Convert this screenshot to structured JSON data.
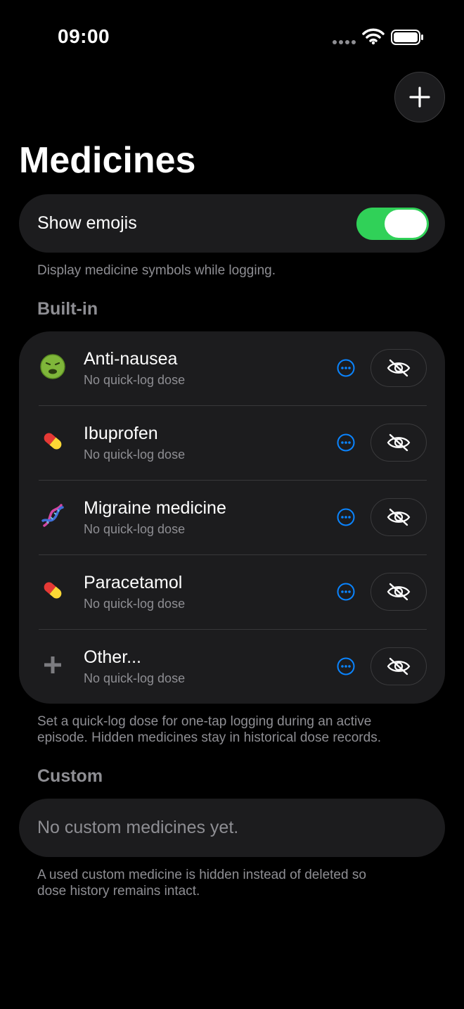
{
  "status_bar": {
    "time": "09:00"
  },
  "page": {
    "title": "Medicines"
  },
  "settings": {
    "show_emojis_label": "Show emojis",
    "show_emojis_on": true,
    "show_emojis_footnote": "Display medicine symbols while logging."
  },
  "builtin": {
    "header": "Built-in",
    "items": [
      {
        "name": "Anti-nausea",
        "subtitle": "No quick-log dose",
        "icon": "nauseated-face-icon"
      },
      {
        "name": "Ibuprofen",
        "subtitle": "No quick-log dose",
        "icon": "pill-icon"
      },
      {
        "name": "Migraine medicine",
        "subtitle": "No quick-log dose",
        "icon": "dna-icon"
      },
      {
        "name": "Paracetamol",
        "subtitle": "No quick-log dose",
        "icon": "pill-icon"
      },
      {
        "name": "Other...",
        "subtitle": "No quick-log dose",
        "icon": "plus-icon"
      }
    ],
    "footnote_line1": "Set a quick-log dose for one-tap logging during an active",
    "footnote_line2": "episode. Hidden medicines stay in historical dose records."
  },
  "custom": {
    "header": "Custom",
    "empty_text": "No custom medicines yet.",
    "footnote_line1": "A used custom medicine is hidden instead of deleted so",
    "footnote_line2": "dose history remains intact."
  },
  "colors": {
    "accent": "#0a84ff",
    "toggle_on": "#30d158",
    "background": "#000000",
    "card": "#1c1c1e"
  }
}
